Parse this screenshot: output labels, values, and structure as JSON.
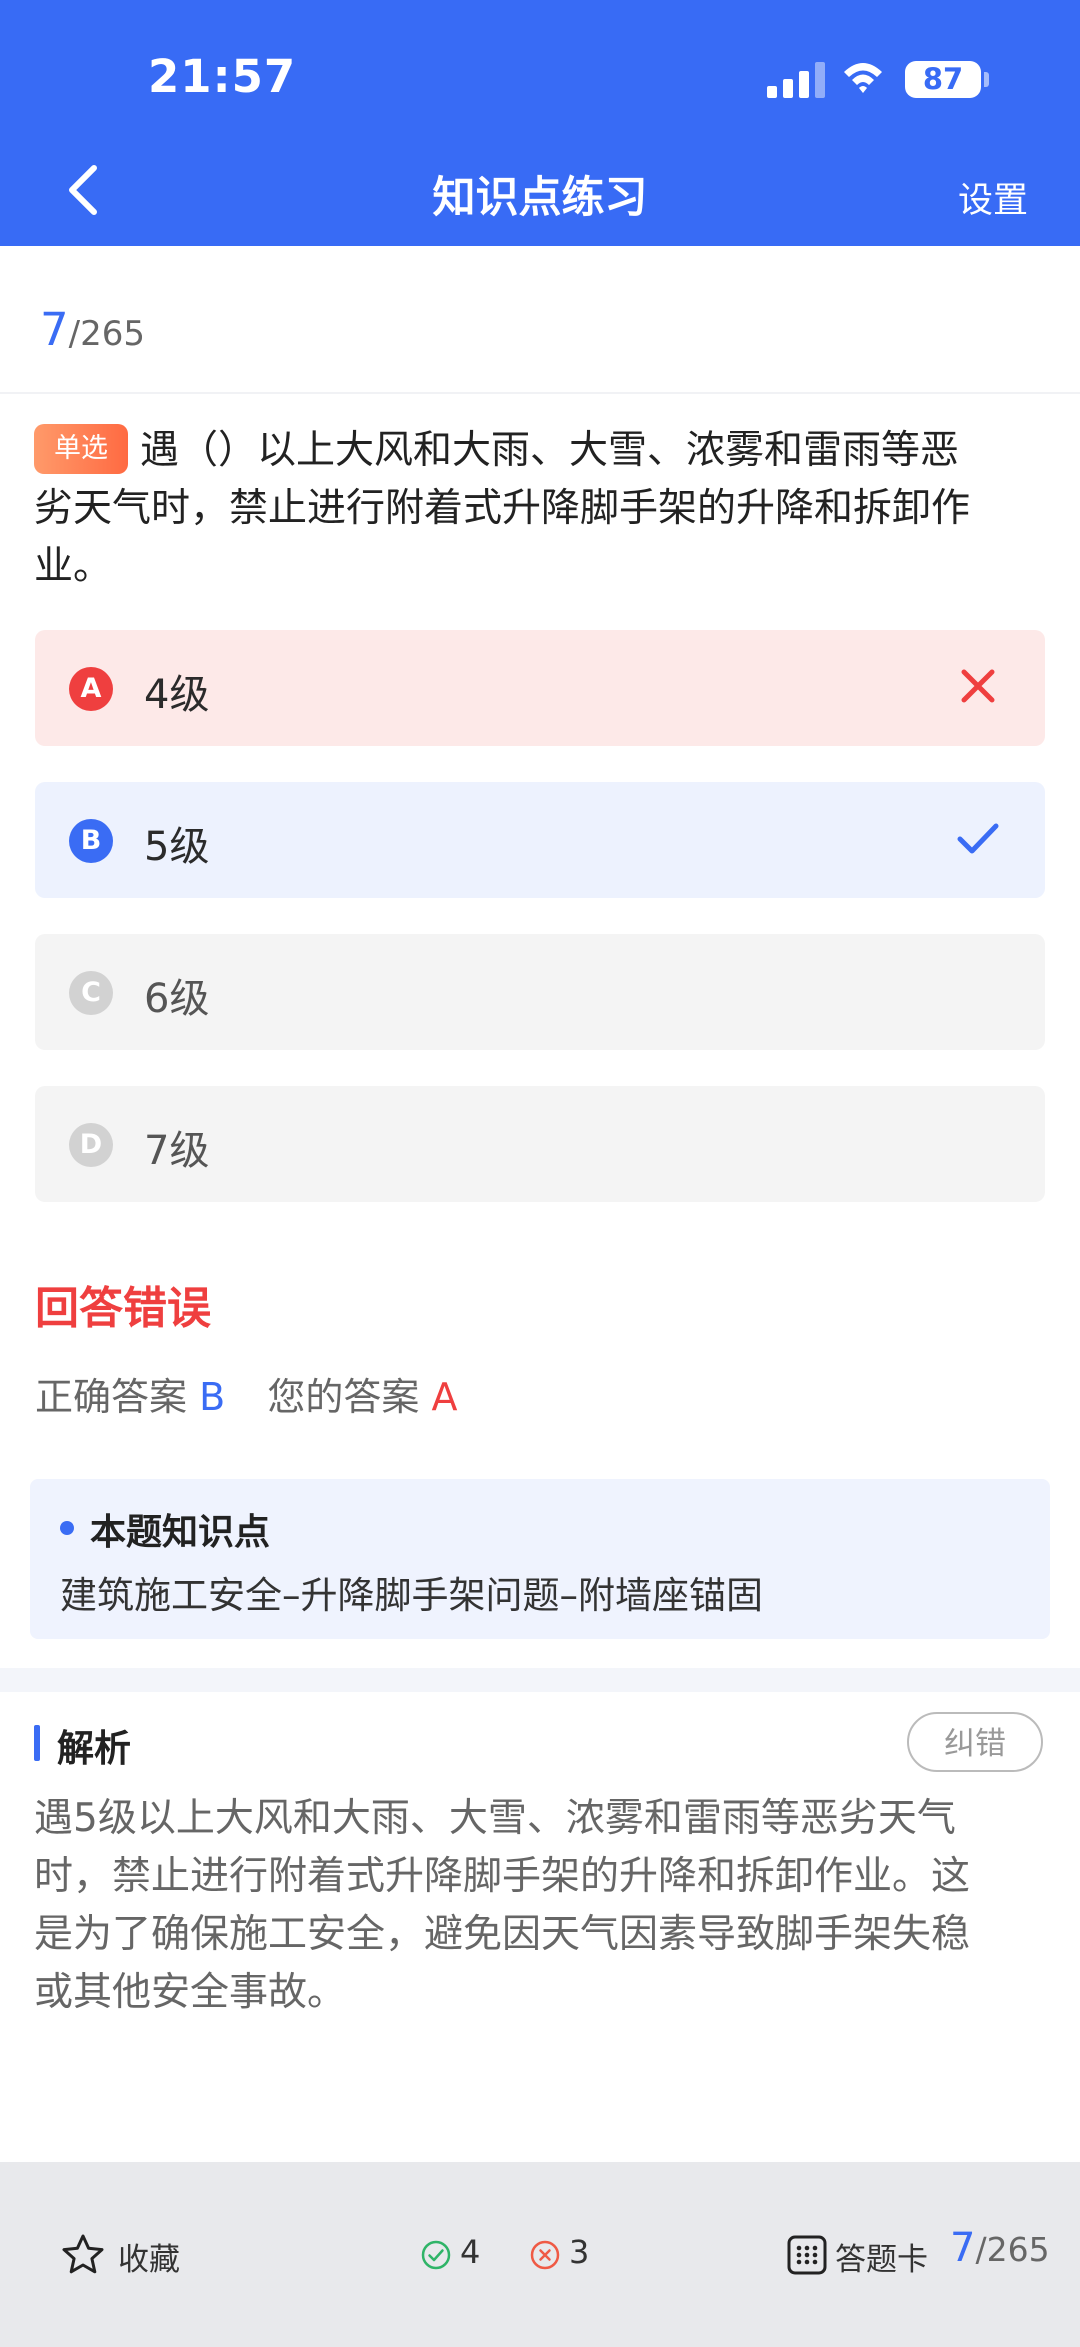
{
  "status_bar": {
    "time": "21:57",
    "battery": "87"
  },
  "header": {
    "title": "知识点练习",
    "settings_label": "设置"
  },
  "progress": {
    "current": "7",
    "total": "/265"
  },
  "question": {
    "type_tag": "单选",
    "lines": [
      "遇（）以上大风和大雨、大雪、浓雾和雷雨等恶",
      "劣天气时，禁止进行附着式升降脚手架的升降和拆卸作",
      "业。"
    ]
  },
  "options": [
    {
      "letter": "A",
      "text": "4级",
      "state": "wrong"
    },
    {
      "letter": "B",
      "text": "5级",
      "state": "correct"
    },
    {
      "letter": "C",
      "text": "6级",
      "state": "neutral"
    },
    {
      "letter": "D",
      "text": "7级",
      "state": "neutral"
    }
  ],
  "result": {
    "title": "回答错误",
    "correct_label": "正确答案",
    "correct_value": "B",
    "yours_label": "您的答案",
    "yours_value": "A"
  },
  "knowledge_point": {
    "title": "本题知识点",
    "text": "建筑施工安全–升降脚手架问题–附墙座锚固"
  },
  "analysis": {
    "title": "解析",
    "report_button": "纠错",
    "lines": [
      "遇5级以上大风和大雨、大雪、浓雾和雷雨等恶劣天气",
      "时，禁止进行附着式升降脚手架的升降和拆卸作业。这",
      "是为了确保施工安全，避免因天气因素导致脚手架失稳",
      "或其他安全事故。"
    ]
  },
  "footer": {
    "favorite_label": "收藏",
    "correct_count": "4",
    "wrong_count": "3",
    "answer_card_label": "答题卡",
    "progress_current": "7",
    "progress_total": "/265"
  },
  "colors": {
    "primary": "#386bf5",
    "error": "#ef3f3f",
    "wrong_bg": "#fde9e8",
    "correct_bg": "#edf2fe",
    "neutral_bg": "#f4f4f4"
  }
}
